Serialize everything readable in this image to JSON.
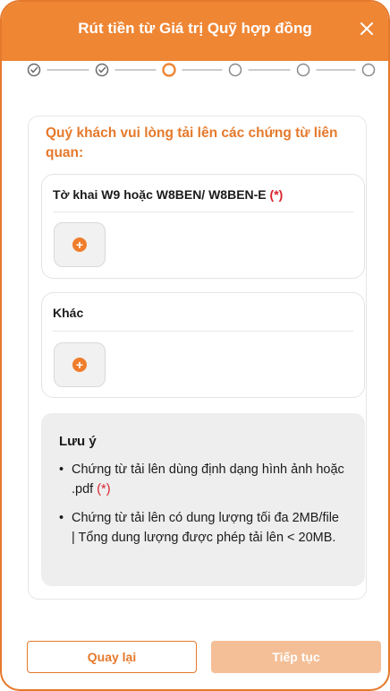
{
  "header": {
    "title": "Rút tiền từ Giá trị Quỹ hợp đồng",
    "close_icon": "close-icon"
  },
  "stepper": {
    "steps": [
      {
        "state": "done"
      },
      {
        "state": "done"
      },
      {
        "state": "current"
      },
      {
        "state": "pending"
      },
      {
        "state": "pending"
      },
      {
        "state": "pending"
      }
    ],
    "colors": {
      "done": "#6b6b6b",
      "current": "#ef8634",
      "pending": "#8a8a8a"
    }
  },
  "main": {
    "instruction": "Quý khách vui lòng tải lên các chứng từ liên quan:",
    "uploads": [
      {
        "label": "Tờ khai W9 hoặc W8BEN/ W8BEN-E",
        "required_mark": "(*)"
      },
      {
        "label": "Khác",
        "required_mark": ""
      }
    ],
    "add_icon": "plus-circle-icon"
  },
  "note": {
    "title": "Lưu ý",
    "items": [
      {
        "text": "Chứng từ tải lên dùng định dạng hình ảnh hoặc .pdf",
        "required_mark": "(*)"
      },
      {
        "text": "Chứng từ tải lên có dung lượng tối đa 2MB/file | Tổng dung lượng được phép tải lên < 20MB.",
        "required_mark": ""
      }
    ],
    "bullet": "•"
  },
  "footer": {
    "back_label": "Quay lại",
    "next_label": "Tiếp tục"
  },
  "colors": {
    "accent": "#ef8634",
    "accent_light": "#f4bf97",
    "required": "#d9232e"
  }
}
